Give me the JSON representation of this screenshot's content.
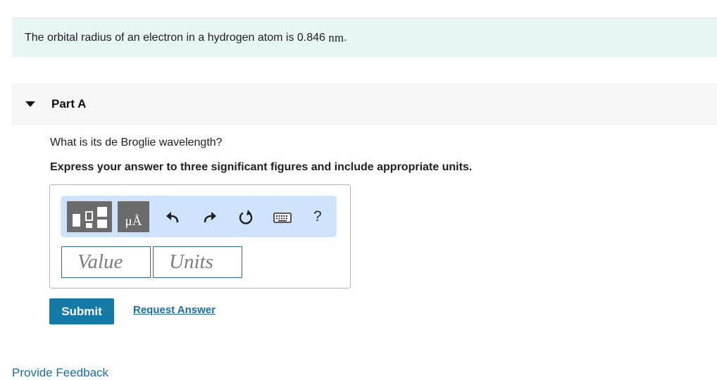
{
  "problem": {
    "statement": "The orbital radius of an electron in a hydrogen atom is 0.846 ",
    "unit": "nm",
    "end": "."
  },
  "part": {
    "title": "Part A",
    "question": "What is its de Broglie wavelength?",
    "instruction": "Express your answer to three significant figures and include appropriate units."
  },
  "toolbar": {
    "units_button_label": "μÅ",
    "help_label": "?",
    "icons": [
      "templates-icon",
      "units-icon",
      "undo-icon",
      "redo-icon",
      "reset-icon",
      "keyboard-icon",
      "help-icon"
    ]
  },
  "inputs": {
    "value_placeholder": "Value",
    "units_placeholder": "Units"
  },
  "actions": {
    "submit_label": "Submit",
    "request_answer_label": "Request Answer",
    "feedback_label": "Provide Feedback"
  },
  "colors": {
    "problem_bg": "#e8f5f6",
    "toolbar_bg": "#cfe3fb",
    "submit_bg": "#157aa5",
    "link": "#1a6f9e"
  }
}
